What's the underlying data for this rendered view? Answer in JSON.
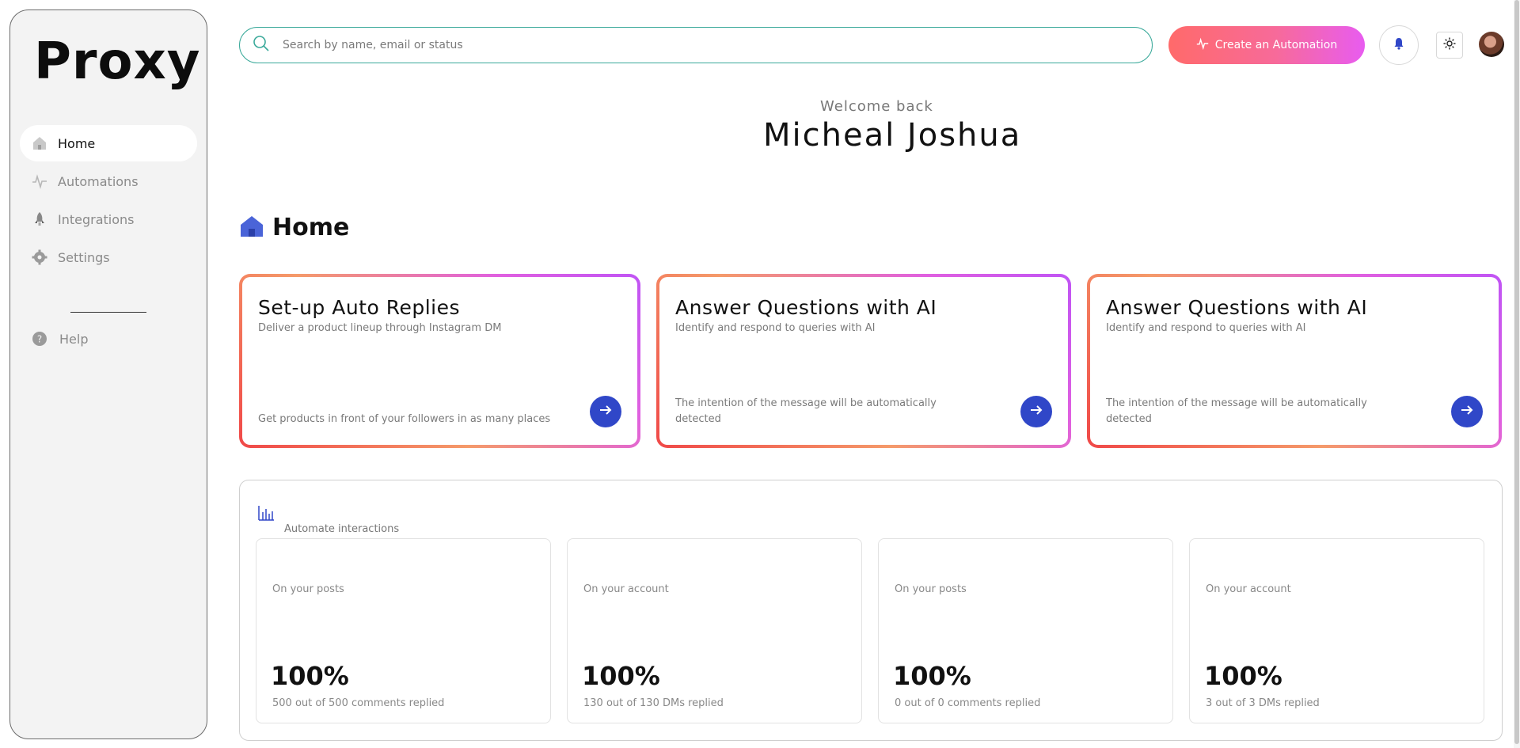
{
  "sidebar": {
    "logo": "Proxy",
    "items": [
      {
        "label": "Home",
        "icon": "home-icon",
        "active": true
      },
      {
        "label": "Automations",
        "icon": "activity-icon",
        "active": false
      },
      {
        "label": "Integrations",
        "icon": "rocket-icon",
        "active": false
      },
      {
        "label": "Settings",
        "icon": "gear-icon",
        "active": false
      }
    ],
    "help_label": "Help"
  },
  "topbar": {
    "search_placeholder": "Search by name, email or status",
    "create_label": "Create an Automation"
  },
  "welcome": {
    "subtitle": "Welcome back",
    "name": "Micheal Joshua"
  },
  "page": {
    "title": "Home"
  },
  "cards": [
    {
      "title": "Set-up Auto Replies",
      "subtitle": "Deliver a product lineup through Instagram DM",
      "footer": "Get products in front of your followers in as many places"
    },
    {
      "title": "Answer Questions with AI",
      "subtitle": "Identify and respond to queries with AI",
      "footer": "The intention of the message will be automatically detected"
    },
    {
      "title": "Answer Questions with AI",
      "subtitle": "Identify and respond to queries with AI",
      "footer": "The intention of the message will be automatically detected"
    }
  ],
  "stats": {
    "label": "Automate interactions",
    "boxes": [
      {
        "on": "On your posts",
        "pct": "100%",
        "desc": "500 out of 500 comments replied"
      },
      {
        "on": "On your account",
        "pct": "100%",
        "desc": "130 out of 130 DMs replied"
      },
      {
        "on": "On your posts",
        "pct": "100%",
        "desc": "0 out of 0 comments replied"
      },
      {
        "on": "On your account",
        "pct": "100%",
        "desc": "3 out of 3 DMs replied"
      }
    ]
  },
  "colors": {
    "accent": "#3047c8",
    "search_border": "#3aa99a",
    "gradient_start": "#ff6a6a",
    "gradient_end": "#e85cf0"
  }
}
